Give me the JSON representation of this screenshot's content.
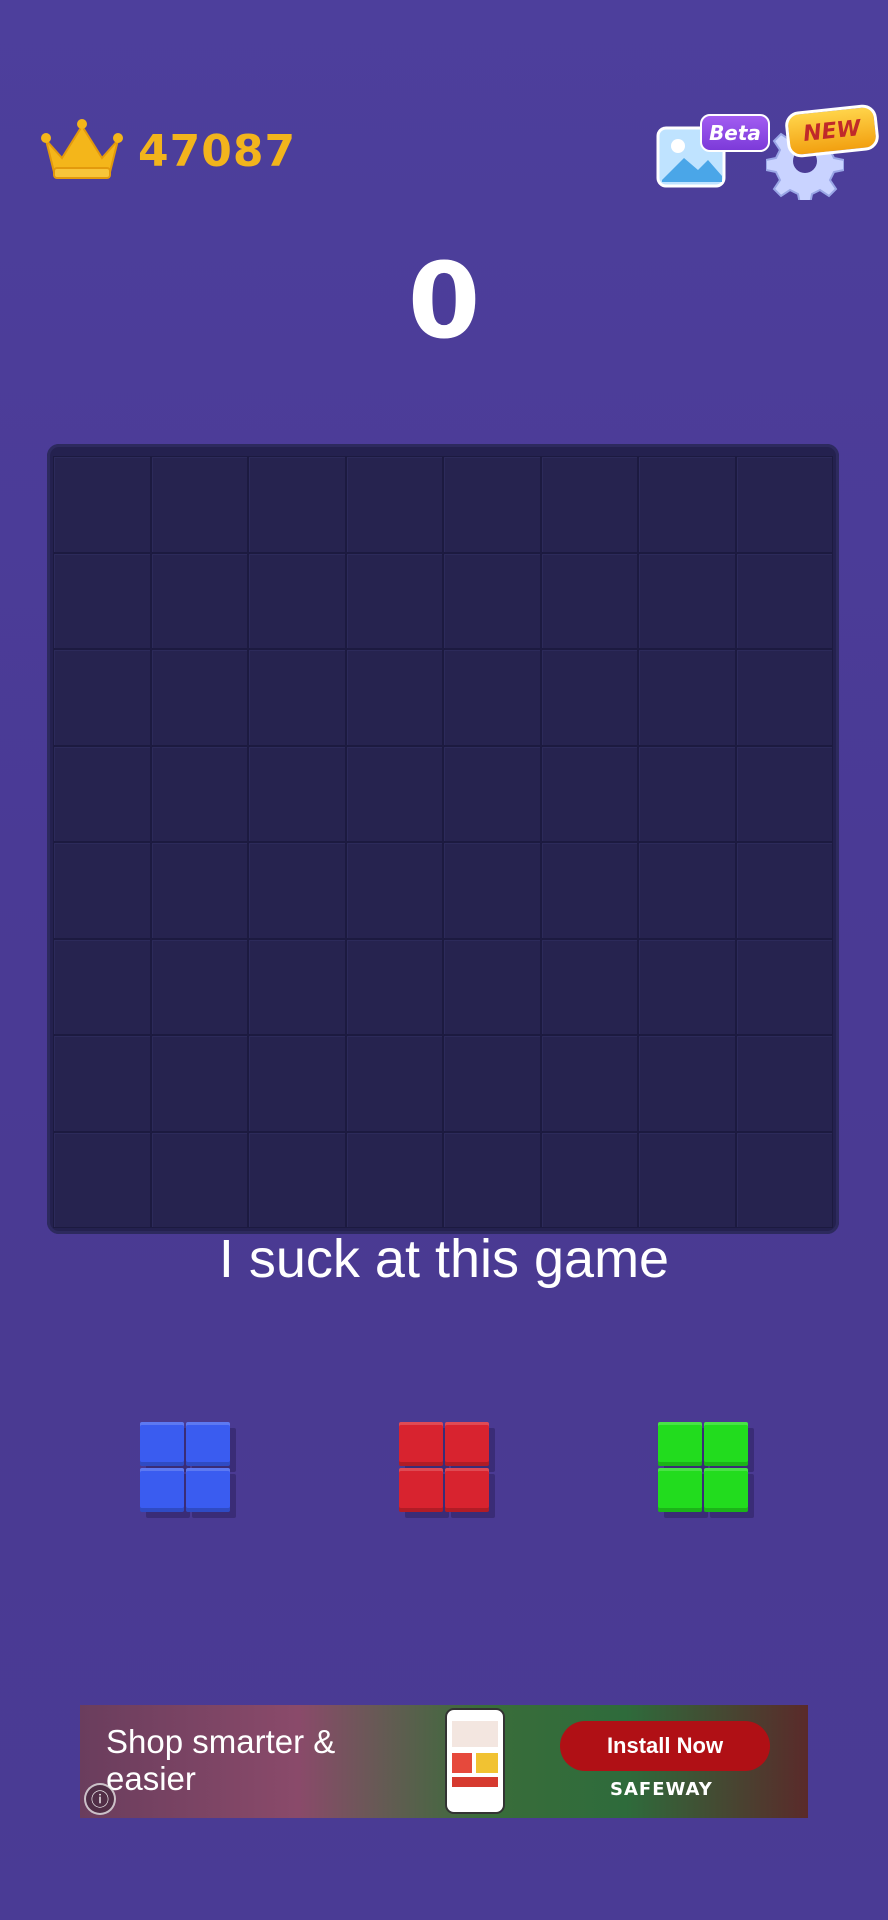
{
  "header": {
    "best_score": "47087",
    "beta_label": "Beta",
    "new_label": "NEW"
  },
  "score": "0",
  "board": {
    "rows": 8,
    "cols": 8,
    "filled_cells": []
  },
  "caption": "I suck at this game",
  "pieces": [
    {
      "name": "blue-2x2",
      "color": "#3a5cf0"
    },
    {
      "name": "red-2x2",
      "color": "#d8232f"
    },
    {
      "name": "green-2x2",
      "color": "#22dc1e"
    }
  ],
  "ad": {
    "headline": "Shop smarter & easier",
    "button_label": "Install Now",
    "brand": "SAFEWAY",
    "info_icon": "ⓘ"
  },
  "colors": {
    "background": "#4a3b95",
    "board": "#24214f",
    "best_score": "#f2b41c"
  }
}
